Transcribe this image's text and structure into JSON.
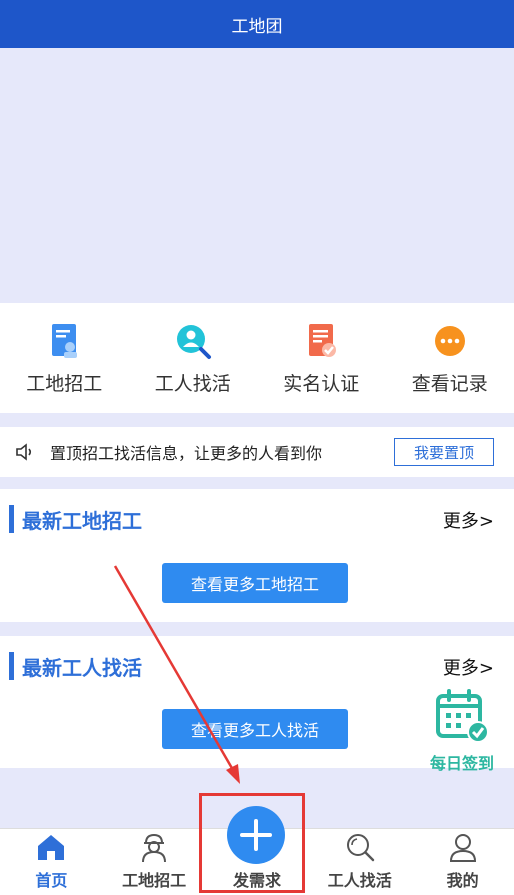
{
  "header": {
    "title": "工地团"
  },
  "quick_nav": [
    {
      "label": "工地招工",
      "icon": "site-recruit-icon"
    },
    {
      "label": "工人找活",
      "icon": "worker-search-icon"
    },
    {
      "label": "实名认证",
      "icon": "realname-cert-icon"
    },
    {
      "label": "查看记录",
      "icon": "view-records-icon"
    }
  ],
  "notice": {
    "text": "置顶招工找活信息，让更多的人看到你",
    "button": "我要置顶"
  },
  "sections": [
    {
      "title": "最新工地招工",
      "more": "更多>",
      "button": "查看更多工地招工"
    },
    {
      "title": "最新工人找活",
      "more": "更多>",
      "button": "查看更多工人找活"
    }
  ],
  "checkin": {
    "label": "每日签到"
  },
  "tabbar": [
    {
      "label": "首页",
      "active": true
    },
    {
      "label": "工地招工"
    },
    {
      "label": "发需求"
    },
    {
      "label": "工人找活"
    },
    {
      "label": "我的"
    }
  ],
  "colors": {
    "header": "#1e56c9",
    "accent": "#2e6fd8",
    "button": "#2f8bf0",
    "checkin": "#2db7a1",
    "highlight": "#e53935"
  }
}
